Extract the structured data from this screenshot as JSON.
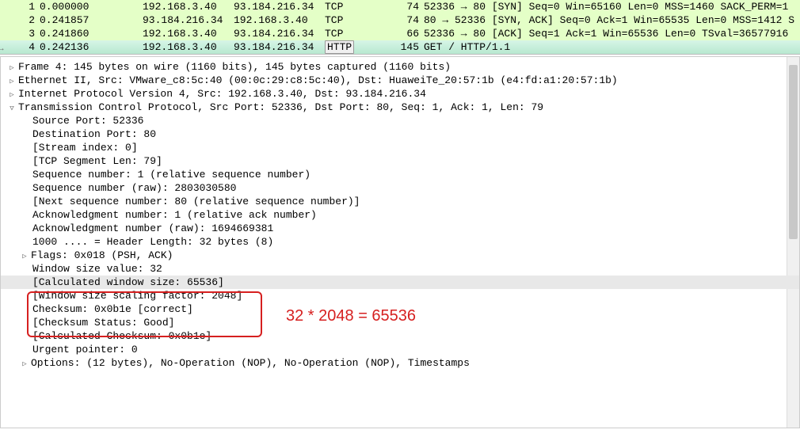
{
  "packets": [
    {
      "no": "1",
      "time": "0.000000",
      "src": "192.168.3.40",
      "dst": "93.184.216.34",
      "proto": "TCP",
      "len": "74",
      "info": "52336 → 80 [SYN] Seq=0 Win=65160 Len=0 MSS=1460 SACK_PERM=1 "
    },
    {
      "no": "2",
      "time": "0.241857",
      "src": "93.184.216.34",
      "dst": "192.168.3.40",
      "proto": "TCP",
      "len": "74",
      "info": "80 → 52336 [SYN, ACK] Seq=0 Ack=1 Win=65535 Len=0 MSS=1412 S"
    },
    {
      "no": "3",
      "time": "0.241860",
      "src": "192.168.3.40",
      "dst": "93.184.216.34",
      "proto": "TCP",
      "len": "66",
      "info": "52336 → 80 [ACK] Seq=1 Ack=1 Win=65536 Len=0 TSval=36577916 "
    },
    {
      "no": "4",
      "time": "0.242136",
      "src": "192.168.3.40",
      "dst": "93.184.216.34",
      "proto": "HTTP",
      "len": "145",
      "info": "GET / HTTP/1.1 "
    }
  ],
  "d": {
    "l0": "Frame 4: 145 bytes on wire (1160 bits), 145 bytes captured (1160 bits)",
    "l1": "Ethernet II, Src: VMware_c8:5c:40 (00:0c:29:c8:5c:40), Dst: HuaweiTe_20:57:1b (e4:fd:a1:20:57:1b)",
    "l2": "Internet Protocol Version 4, Src: 192.168.3.40, Dst: 93.184.216.34",
    "l3": "Transmission Control Protocol, Src Port: 52336, Dst Port: 80, Seq: 1, Ack: 1, Len: 79",
    "l4": "Source Port: 52336",
    "l5": "Destination Port: 80",
    "l6": "[Stream index: 0]",
    "l7": "[TCP Segment Len: 79]",
    "l8": "Sequence number: 1    (relative sequence number)",
    "l9": "Sequence number (raw): 2803030580",
    "l10": "[Next sequence number: 80    (relative sequence number)]",
    "l11": "Acknowledgment number: 1    (relative ack number)",
    "l12": "Acknowledgment number (raw): 1694669381",
    "l13": "1000 .... = Header Length: 32 bytes (8)",
    "l14": "Flags: 0x018 (PSH, ACK)",
    "l15": "Window size value: 32",
    "l16": "[Calculated window size: 65536]",
    "l17": "[Window size scaling factor: 2048]",
    "l18": "Checksum: 0x0b1e [correct]",
    "l19": "[Checksum Status: Good]",
    "l20": "[Calculated Checksum: 0x0b1e]",
    "l21": "Urgent pointer: 0",
    "l22": "Options: (12 bytes), No-Operation (NOP), No-Operation (NOP), Timestamps"
  },
  "annotation": "32 * 2048 = 65536"
}
